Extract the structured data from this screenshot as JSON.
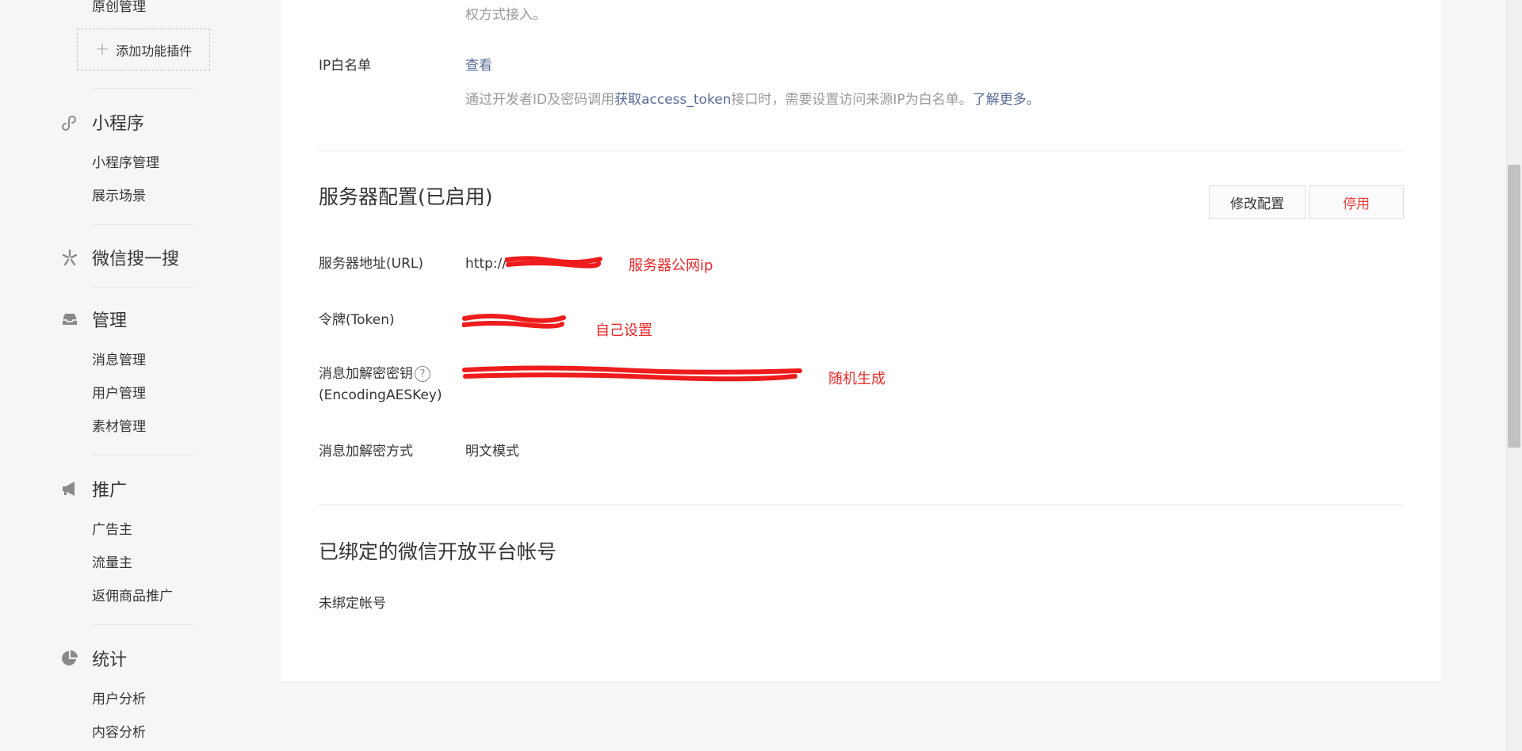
{
  "sidebar": {
    "top_link": "原创管理",
    "add_plugin": "添加功能插件",
    "categories": [
      {
        "label": "小程序",
        "items": [
          "小程序管理",
          "展示场景"
        ]
      },
      {
        "label": "微信搜一搜",
        "items": []
      },
      {
        "label": "管理",
        "items": [
          "消息管理",
          "用户管理",
          "素材管理"
        ]
      },
      {
        "label": "推广",
        "items": [
          "广告主",
          "流量主",
          "返佣商品推广"
        ]
      },
      {
        "label": "统计",
        "items": [
          "用户分析",
          "内容分析"
        ]
      }
    ]
  },
  "main": {
    "top_tip": "权方式接入。",
    "ip_whitelist": {
      "label": "IP白名单",
      "view_link": "查看",
      "tip_prefix": "通过开发者ID及密码调用",
      "tip_link": "获取access_token",
      "tip_middle": "接口时，需要设置访问来源IP为白名单。",
      "tip_more": "了解更多。"
    },
    "server_config": {
      "title": "服务器配置(已启用)",
      "modify_button": "修改配置",
      "disable_button": "停用",
      "url_label": "服务器地址(URL)",
      "url_value": "http://",
      "url_annotation": "服务器公网ip",
      "token_label": "令牌(Token)",
      "token_annotation": "自己设置",
      "aes_label_line1": "消息加解密密钥",
      "aes_help": "?",
      "aes_label_line2": "(EncodingAESKey)",
      "aes_annotation": "随机生成",
      "mode_label": "消息加解密方式",
      "mode_value": "明文模式"
    },
    "bound_platform": {
      "title": "已绑定的微信开放平台帐号",
      "status": "未绑定帐号"
    }
  },
  "colors": {
    "link": "#576b95",
    "annotation": "#e62a2a",
    "danger": "#e64340"
  }
}
